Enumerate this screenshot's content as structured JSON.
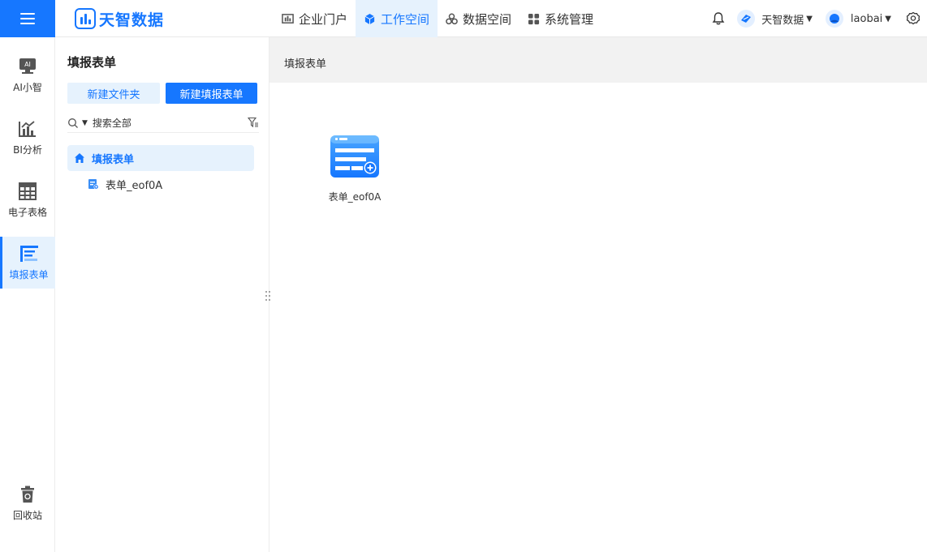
{
  "app": {
    "brand_name": "天智数据"
  },
  "nav": {
    "items": [
      {
        "label": "企业门户",
        "icon": "portal-icon",
        "active": false
      },
      {
        "label": "工作空间",
        "icon": "workspace-cube-icon",
        "active": true
      },
      {
        "label": "数据空间",
        "icon": "data-space-icon",
        "active": false
      },
      {
        "label": "系统管理",
        "icon": "system-grid-icon",
        "active": false
      }
    ]
  },
  "header_right": {
    "org_name": "天智数据",
    "user_name": "laobai"
  },
  "rail": {
    "items": [
      {
        "label": "AI小智",
        "icon": "ai-assistant-icon",
        "active": false
      },
      {
        "label": "BI分析",
        "icon": "bi-chart-icon",
        "active": false
      },
      {
        "label": "电子表格",
        "icon": "spreadsheet-icon",
        "active": false
      },
      {
        "label": "填报表单",
        "icon": "form-icon",
        "active": true
      }
    ],
    "recycle_label": "回收站"
  },
  "panel": {
    "title": "填报表单",
    "new_folder_label": "新建文件夹",
    "new_form_label": "新建填报表单",
    "search_placeholder": "搜索全部",
    "tree_root_label": "填报表单",
    "tree_children": [
      {
        "label": "表单_eof0A"
      }
    ]
  },
  "main": {
    "breadcrumb_title": "填报表单",
    "files": [
      {
        "name": "表单_eof0A",
        "icon": "form-file-icon"
      }
    ]
  },
  "colors": {
    "accent": "#1677ff",
    "accent_light": "#e6f2fd",
    "header_bg": "#f2f2f2"
  }
}
